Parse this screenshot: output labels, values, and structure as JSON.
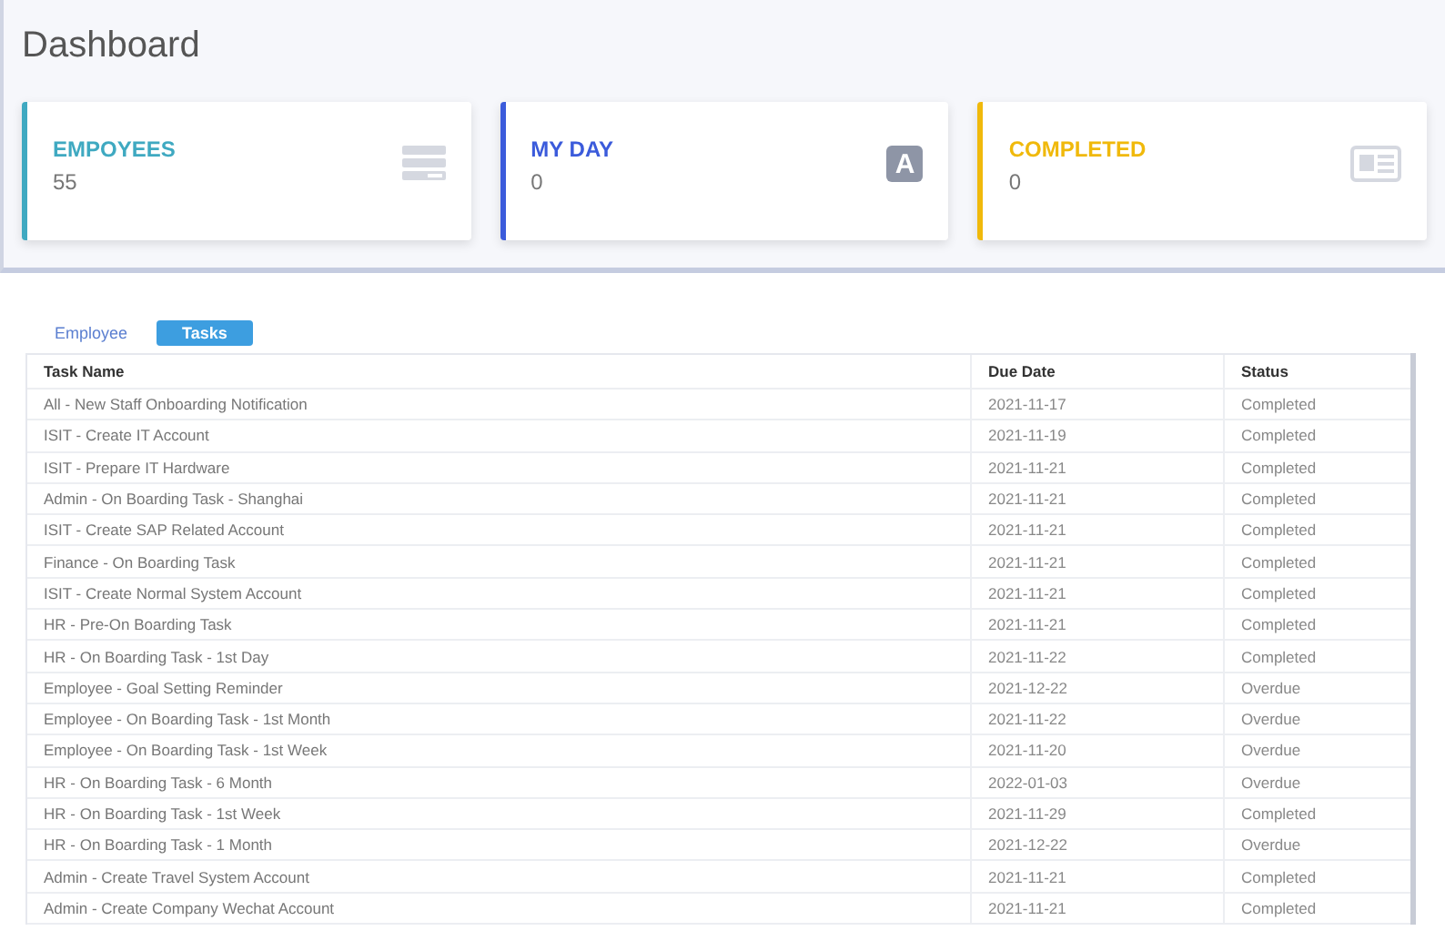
{
  "title": "Dashboard",
  "cards": [
    {
      "label": "EMPOYEES",
      "value": "55",
      "color": "#3fa9c1",
      "kind": "server"
    },
    {
      "label": "MY DAY",
      "value": "0",
      "color": "#3b5bdb",
      "kind": "letter",
      "icon_text": "A"
    },
    {
      "label": "COMPLETED",
      "value": "0",
      "color": "#f0b90b",
      "kind": "news"
    }
  ],
  "tabs": [
    {
      "label": "Employee",
      "selected": false
    },
    {
      "label": "Tasks",
      "selected": true
    }
  ],
  "table": {
    "columns": [
      "Task Name",
      "Due Date",
      "Status"
    ],
    "rows": [
      [
        "All - New Staff Onboarding Notification",
        "2021-11-17",
        "Completed"
      ],
      [
        "ISIT - Create IT Account",
        "2021-11-19",
        "Completed"
      ],
      [
        "ISIT - Prepare IT Hardware",
        "2021-11-21",
        "Completed"
      ],
      [
        "Admin - On Boarding Task - Shanghai",
        "2021-11-21",
        "Completed"
      ],
      [
        "ISIT - Create SAP Related Account",
        "2021-11-21",
        "Completed"
      ],
      [
        "Finance - On Boarding Task",
        "2021-11-21",
        "Completed"
      ],
      [
        "ISIT - Create Normal System Account",
        "2021-11-21",
        "Completed"
      ],
      [
        "HR - Pre-On Boarding Task",
        "2021-11-21",
        "Completed"
      ],
      [
        "HR - On Boarding Task - 1st Day",
        "2021-11-22",
        "Completed"
      ],
      [
        "Employee - Goal Setting Reminder",
        "2021-12-22",
        "Overdue"
      ],
      [
        "Employee - On Boarding Task - 1st Month",
        "2021-11-22",
        "Overdue"
      ],
      [
        "Employee - On Boarding Task - 1st Week",
        "2021-11-20",
        "Overdue"
      ],
      [
        "HR - On Boarding Task - 6 Month",
        "2022-01-03",
        "Overdue"
      ],
      [
        "HR - On Boarding Task - 1st Week",
        "2021-11-29",
        "Completed"
      ],
      [
        "HR - On Boarding Task - 1 Month",
        "2021-12-22",
        "Overdue"
      ],
      [
        "Admin - Create Travel System Account",
        "2021-11-21",
        "Completed"
      ],
      [
        "Admin - Create Company Wechat Account",
        "2021-11-21",
        "Completed"
      ]
    ]
  }
}
